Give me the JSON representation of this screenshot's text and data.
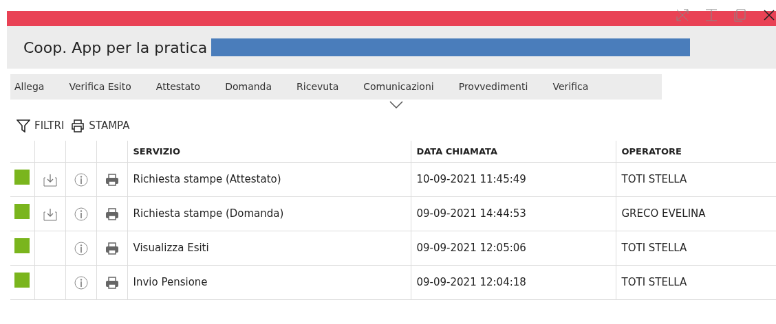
{
  "window": {
    "title": "Coop. App per la pratica"
  },
  "tabs": [
    {
      "label": "Allega",
      "selected": false
    },
    {
      "label": "Verifica Esito",
      "selected": false
    },
    {
      "label": "Attestato",
      "selected": false
    },
    {
      "label": "Domanda",
      "selected": false
    },
    {
      "label": "Ricevuta",
      "selected": false
    },
    {
      "label": "Comunicazioni",
      "selected": false
    },
    {
      "label": "Provvedimenti",
      "selected": false
    },
    {
      "label": "Verifica",
      "selected": false
    }
  ],
  "toolbar": [
    {
      "kind": "filter",
      "label": "FILTRI"
    },
    {
      "kind": "print",
      "label": "STAMPA"
    }
  ],
  "table": {
    "columns": [
      "SERVIZIO",
      "DATA CHIAMATA",
      "OPERATORE"
    ],
    "rows": [
      {
        "color": "#7ab51d",
        "download": true,
        "servizio": "Richiesta stampe (Attestato)",
        "data": "10-09-2021 11:45:49",
        "operatore": "TOTI STELLA"
      },
      {
        "color": "#7ab51d",
        "download": true,
        "servizio": "Richiesta stampe (Domanda)",
        "data": "09-09-2021 14:44:53",
        "operatore": "GRECO EVELINA"
      },
      {
        "color": "#7ab51d",
        "download": false,
        "servizio": "Visualizza Esiti",
        "data": "09-09-2021 12:05:06",
        "operatore": "TOTI STELLA"
      },
      {
        "color": "#7ab51d",
        "download": false,
        "servizio": "Invio Pensione",
        "data": "09-09-2021 12:04:18",
        "operatore": "TOTI STELLA"
      }
    ]
  }
}
